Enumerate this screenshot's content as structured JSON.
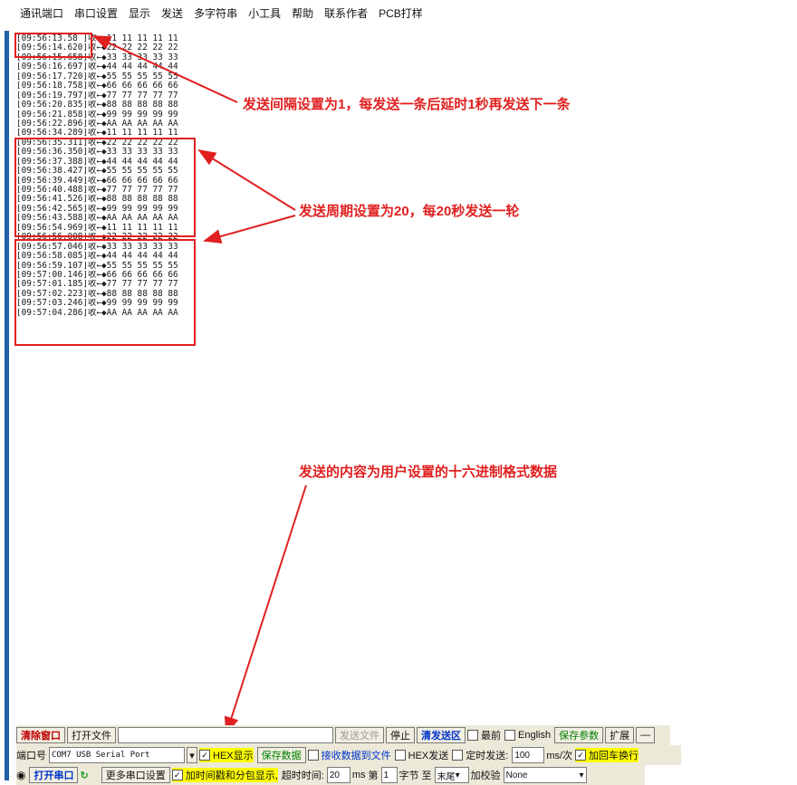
{
  "menu": [
    "通讯端口",
    "串口设置",
    "显示",
    "发送",
    "多字符串",
    "小工具",
    "帮助",
    "联系作者",
    "PCB打样"
  ],
  "log_lines": [
    "[09:56:13.58 ]收←◆11 11 11 11 11",
    "[09:56:14.620]收←◆22 22 22 22 22",
    "[09:56:15.658]收←◆33 33 33 33 33",
    "[09:56:16.697]收←◆44 44 44 44 44",
    "[09:56:17.720]收←◆55 55 55 55 55",
    "[09:56:18.758]收←◆66 66 66 66 66",
    "[09:56:19.797]收←◆77 77 77 77 77",
    "[09:56:20.835]收←◆88 88 88 88 88",
    "[09:56:21.858]收←◆99 99 99 99 99",
    "[09:56:22.896]收←◆AA AA AA AA AA",
    "[09:56:34.289]收←◆11 11 11 11 11",
    "[09:56:35.311]收←◆22 22 22 22 22",
    "[09:56:36.350]收←◆33 33 33 33 33",
    "[09:56:37.388]收←◆44 44 44 44 44",
    "[09:56:38.427]收←◆55 55 55 55 55",
    "[09:56:39.449]收←◆66 66 66 66 66",
    "[09:56:40.488]收←◆77 77 77 77 77",
    "[09:56:41.526]收←◆88 88 88 88 88",
    "[09:56:42.565]收←◆99 99 99 99 99",
    "[09:56:43.588]收←◆AA AA AA AA AA",
    "[09:56:54.969]收←◆11 11 11 11 11",
    "[09:56:56.008]收←◆22 22 22 22 22",
    "[09:56:57.046]收←◆33 33 33 33 33",
    "[09:56:58.085]收←◆44 44 44 44 44",
    "[09:56:59.107]收←◆55 55 55 55 55",
    "[09:57:00.146]收←◆66 66 66 66 66",
    "[09:57:01.185]收←◆77 77 77 77 77",
    "[09:57:02.223]收←◆88 88 88 88 88",
    "[09:57:03.246]收←◆99 99 99 99 99",
    "[09:57:04.286]收←◆AA AA AA AA AA"
  ],
  "annotations": {
    "interval": "发送间隔设置为1，每发送一条后延时1秒再发送下一条",
    "period": "发送周期设置为20，每20秒发送一轮",
    "content": "发送的内容为用户设置的十六进制格式数据"
  },
  "toolbar1": {
    "clear_window": "清除窗口",
    "open_file": "打开文件",
    "send_file": "发送文件",
    "stop": "停止",
    "clear_send": "清发送区",
    "topmost": "最前",
    "english": "English",
    "save_params": "保存参数",
    "expand": "扩展",
    "minus": "—"
  },
  "toolbar2": {
    "port_label": "端口号",
    "port_value": "COM7 USB Serial Port",
    "hex_display": "HEX显示",
    "save_data": "保存数据",
    "recv_to_file": "接收数据到文件",
    "hex_send": "HEX发送",
    "timed_send": "定时发送:",
    "interval_value": "100",
    "interval_unit": "ms/次",
    "add_crlf": "加回车换行"
  },
  "toolbar3": {
    "open_port": "打开串口",
    "more_settings": "更多串口设置",
    "timestamp": "加时间戳和分包显示,",
    "timeout_label": "超时时间:",
    "timeout_value": "20",
    "timeout_unit": "ms",
    "byte_prefix": "第",
    "byte_value": "1",
    "byte_label": "字节 至",
    "end_value": "末尾",
    "checksum_label": "加校验",
    "checksum_value": "None"
  },
  "colors": {
    "annotation": "#e02020",
    "sidebar": "#1e5fa8",
    "highlight": "#ffff00"
  }
}
